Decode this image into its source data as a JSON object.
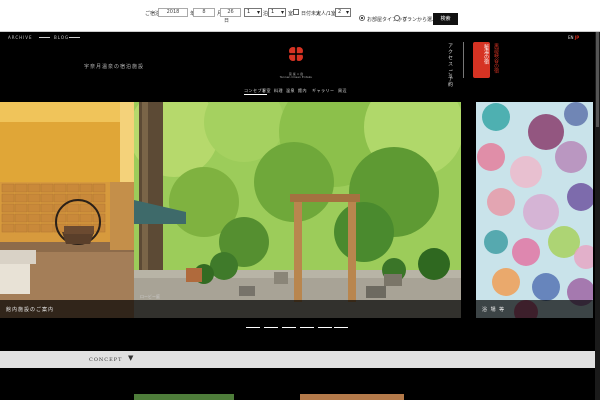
{
  "booking": {
    "year_label": "ご宿泊日",
    "year": "2018",
    "month_label": "年",
    "month": "8",
    "day_label": "月",
    "day": "26",
    "day_suffix": "日",
    "nights": "1",
    "nights_label": "泊",
    "rooms": "1",
    "rooms_label": "室",
    "undecided_label": "日付未定",
    "adults_label": "大人/1室",
    "adults": "2",
    "radio_1_label": "お部屋タイプから",
    "radio_2_label": "プランから選ぶ",
    "search_button": "検索"
  },
  "header": {
    "link_left_1": "ARCHIVE",
    "link_left_2": "BLOG",
    "lang": "EN",
    "lang_active": "JP",
    "tagline": "宇奈月温泉の宿泊施設",
    "logo_line_1": "延 楽 × 宿",
    "logo_line_2": "Tennen Onsen Entaku",
    "access_vertical": "アクセス ご予約",
    "seal_text": "秘湯の宿",
    "seal_vertical": "黒部峡谷の宿",
    "nav": [
      "コンセプト",
      "客室",
      "料理",
      "温泉",
      "館内",
      "ギャラリー",
      "周辺"
    ]
  },
  "slides": {
    "slide_1_caption": "館内施設のご案内",
    "slide_2_sub": "ロービー庭",
    "slide_3_caption": "浴 場 等"
  },
  "concept": {
    "label": "CONCEPT"
  },
  "colors": {
    "seal_red": "#d63323",
    "booking_bg": "#ffffff",
    "concept_bg": "#e1e1e1"
  }
}
